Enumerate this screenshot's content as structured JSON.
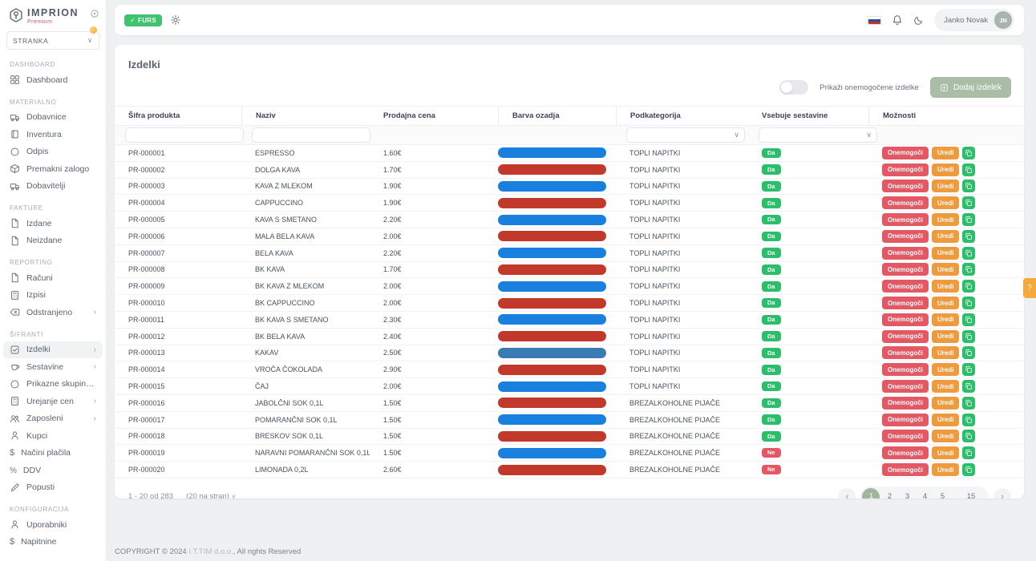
{
  "colors": {
    "bar_blue": "#1a80e0",
    "bar_red": "#c2392b",
    "bar_steel": "#3a7cb1",
    "badge_green": "#2cbe6a",
    "badge_red": "#e45864",
    "edit_orange": "#f09a3e",
    "add_button": "#a9bda7",
    "active_page_green": "#9fb69b",
    "furs_green": "#3ec46d",
    "help_orange": "#f5a93b"
  },
  "sidebar": {
    "logo_name": "IMPRION",
    "logo_tier": "Premium",
    "client_select_value": "STRANKA",
    "sections": [
      {
        "label": "DASHBOARD",
        "items": [
          {
            "label": "Dashboard",
            "icon": "grid"
          }
        ]
      },
      {
        "label": "MATERIALNO",
        "items": [
          {
            "label": "Dobavnice",
            "icon": "truck"
          },
          {
            "label": "Inventura",
            "icon": "book"
          },
          {
            "label": "Odpis",
            "icon": "circle"
          },
          {
            "label": "Premakni zalogo",
            "icon": "package"
          },
          {
            "label": "Dobavitelji",
            "icon": "truck"
          }
        ]
      },
      {
        "label": "FAKTURE",
        "items": [
          {
            "label": "Izdane",
            "icon": "file"
          },
          {
            "label": "Neizdane",
            "icon": "file"
          }
        ]
      },
      {
        "label": "REPORTING",
        "items": [
          {
            "label": "Računi",
            "icon": "file"
          },
          {
            "label": "Izpisi",
            "icon": "calculator"
          },
          {
            "label": "Odstranjeno",
            "icon": "backspace",
            "expandable": true
          }
        ]
      },
      {
        "label": "ŠIFRANTI",
        "items": [
          {
            "label": "Izdelki",
            "icon": "product",
            "expandable": true,
            "active": true
          },
          {
            "label": "Sestavine",
            "icon": "cup",
            "expandable": true
          },
          {
            "label": "Prikazne skupine iz...",
            "icon": "circle"
          },
          {
            "label": "Urejanje cen",
            "icon": "calculator",
            "expandable": true
          },
          {
            "label": "Zaposleni",
            "icon": "users",
            "expandable": true
          },
          {
            "label": "Kupci",
            "icon": "user"
          },
          {
            "label": "Načini plačila",
            "icon": "dollar"
          },
          {
            "label": "DDV",
            "icon": "percent"
          },
          {
            "label": "Popusti",
            "icon": "pencil"
          }
        ]
      },
      {
        "label": "KONFIGURACIJA",
        "items": [
          {
            "label": "Uporabniki",
            "icon": "user"
          },
          {
            "label": "Napitnine",
            "icon": "dollar"
          }
        ]
      }
    ]
  },
  "topbar": {
    "furs_label": "FURS",
    "user_name": "Janko Novak",
    "user_initials": "JN"
  },
  "main": {
    "title": "Izdelki",
    "toggle_label": "Prikaži onemogočene izdelke",
    "add_button_label": "Dodaj izdelek",
    "table": {
      "columns": [
        {
          "label": "Šifra produkta",
          "filter": "input"
        },
        {
          "label": "Naziv",
          "filter": "input",
          "sep": true
        },
        {
          "label": "Prodajna cena"
        },
        {
          "label": "Barva ozadja",
          "sep": true
        },
        {
          "label": "Podkategorija",
          "filter": "select",
          "sep": true
        },
        {
          "label": "Vsebuje sestavine",
          "filter": "select"
        },
        {
          "label": "Možnosti",
          "sep": true
        }
      ],
      "action_labels": {
        "disable": "Onemogoči",
        "edit": "Uredi"
      },
      "rows": [
        {
          "code": "PR-000001",
          "name": "ESPRESSO",
          "price": "1.60€",
          "bar": "#1a80e0",
          "subcategory": "TOPLI NAPITKI",
          "ingredients": "Da"
        },
        {
          "code": "PR-000002",
          "name": "DOLGA KAVA",
          "price": "1.70€",
          "bar": "#c2392b",
          "subcategory": "TOPLI NAPITKI",
          "ingredients": "Da"
        },
        {
          "code": "PR-000003",
          "name": "KAVA Z MLEKOM",
          "price": "1.90€",
          "bar": "#1a80e0",
          "subcategory": "TOPLI NAPITKI",
          "ingredients": "Da"
        },
        {
          "code": "PR-000004",
          "name": "CAPPUCCINO",
          "price": "1.90€",
          "bar": "#c2392b",
          "subcategory": "TOPLI NAPITKI",
          "ingredients": "Da"
        },
        {
          "code": "PR-000005",
          "name": "KAVA S SMETANO",
          "price": "2.20€",
          "bar": "#1a80e0",
          "subcategory": "TOPLI NAPITKI",
          "ingredients": "Da"
        },
        {
          "code": "PR-000006",
          "name": "MALA BELA KAVA",
          "price": "2.00€",
          "bar": "#c2392b",
          "subcategory": "TOPLI NAPITKI",
          "ingredients": "Da"
        },
        {
          "code": "PR-000007",
          "name": "BELA KAVA",
          "price": "2.20€",
          "bar": "#1a80e0",
          "subcategory": "TOPLI NAPITKI",
          "ingredients": "Da"
        },
        {
          "code": "PR-000008",
          "name": "BK KAVA",
          "price": "1.70€",
          "bar": "#c2392b",
          "subcategory": "TOPLI NAPITKI",
          "ingredients": "Da"
        },
        {
          "code": "PR-000009",
          "name": "BK KAVA Z MLEKOM",
          "price": "2.00€",
          "bar": "#1a80e0",
          "subcategory": "TOPLI NAPITKI",
          "ingredients": "Da"
        },
        {
          "code": "PR-000010",
          "name": "BK CAPPUCCINO",
          "price": "2.00€",
          "bar": "#c2392b",
          "subcategory": "TOPLI NAPITKI",
          "ingredients": "Da"
        },
        {
          "code": "PR-000011",
          "name": "BK KAVA S SMETANO",
          "price": "2.30€",
          "bar": "#1a80e0",
          "subcategory": "TOPLI NAPITKI",
          "ingredients": "Da"
        },
        {
          "code": "PR-000012",
          "name": "BK BELA KAVA",
          "price": "2.40€",
          "bar": "#c2392b",
          "subcategory": "TOPLI NAPITKI",
          "ingredients": "Da"
        },
        {
          "code": "PR-000013",
          "name": "KAKAV",
          "price": "2.50€",
          "bar": "#3a7cb1",
          "subcategory": "TOPLI NAPITKI",
          "ingredients": "Da"
        },
        {
          "code": "PR-000014",
          "name": "VROČA ČOKOLADA",
          "price": "2.90€",
          "bar": "#c2392b",
          "subcategory": "TOPLI NAPITKI",
          "ingredients": "Da"
        },
        {
          "code": "PR-000015",
          "name": "ČAJ",
          "price": "2.00€",
          "bar": "#1a80e0",
          "subcategory": "TOPLI NAPITKI",
          "ingredients": "Da"
        },
        {
          "code": "PR-000016",
          "name": "JABOLČNI SOK 0,1L",
          "price": "1.50€",
          "bar": "#c2392b",
          "subcategory": "BREZALKOHOLNE PIJAČE",
          "ingredients": "Da"
        },
        {
          "code": "PR-000017",
          "name": "POMARANČNI SOK 0,1L",
          "price": "1.50€",
          "bar": "#1a80e0",
          "subcategory": "BREZALKOHOLNE PIJAČE",
          "ingredients": "Da"
        },
        {
          "code": "PR-000018",
          "name": "BRESKOV SOK 0,1L",
          "price": "1.50€",
          "bar": "#c2392b",
          "subcategory": "BREZALKOHOLNE PIJAČE",
          "ingredients": "Da"
        },
        {
          "code": "PR-000019",
          "name": "NARAVNI POMARANČNI SOK 0,1L",
          "price": "1.50€",
          "bar": "#1a80e0",
          "subcategory": "BREZALKOHOLNE PIJAČE",
          "ingredients": "Ne"
        },
        {
          "code": "PR-000020",
          "name": "LIMONADA 0,2L",
          "price": "2.60€",
          "bar": "#c2392b",
          "subcategory": "BREZALKOHOLNE PIJAČE",
          "ingredients": "Ne"
        }
      ]
    },
    "pagination": {
      "range_text": "1 - 20 od 283",
      "per_page_text": "(20 na stran)",
      "pages": [
        "1",
        "2",
        "3",
        "4",
        "5",
        "...",
        "15"
      ],
      "active_page": "1",
      "prev_label": "‹",
      "next_label": "›"
    }
  },
  "footer": {
    "prefix": "COPYRIGHT © 2024 ",
    "company": "I.T.TIM d.o.o.",
    "suffix": ", All rights Reserved"
  },
  "help_tab_label": "?"
}
